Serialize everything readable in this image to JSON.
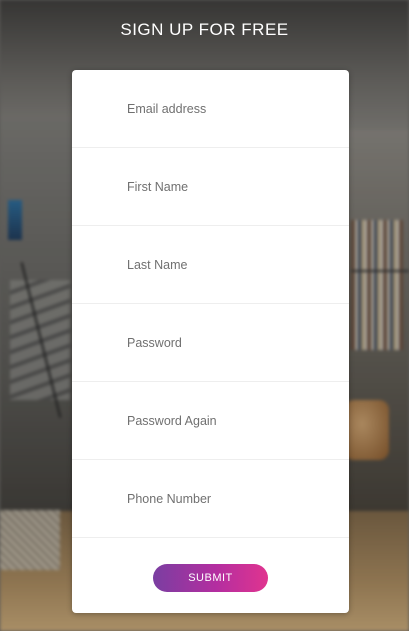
{
  "header": {
    "title": "SIGN UP FOR FREE"
  },
  "form": {
    "fields": [
      {
        "placeholder": "Email address",
        "value": ""
      },
      {
        "placeholder": "First Name",
        "value": ""
      },
      {
        "placeholder": "Last Name",
        "value": ""
      },
      {
        "placeholder": "Password",
        "value": ""
      },
      {
        "placeholder": "Password Again",
        "value": ""
      },
      {
        "placeholder": "Phone Number",
        "value": ""
      }
    ],
    "submit_label": "SUBMIT"
  },
  "colors": {
    "card_background": "#ffffff",
    "title_text": "#ffffff",
    "submit_gradient_start": "#7a3ea1",
    "submit_gradient_end": "#e0348f"
  }
}
